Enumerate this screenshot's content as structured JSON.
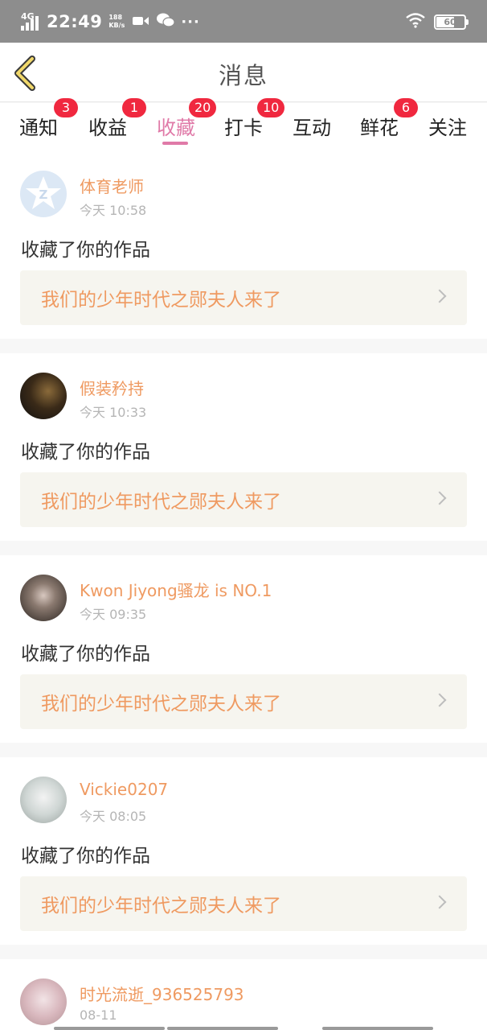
{
  "status_bar": {
    "network": "4G",
    "time": "22:49",
    "speed_value": "188",
    "speed_unit": "KB/s",
    "battery": "60"
  },
  "header": {
    "title": "消息"
  },
  "tabs": [
    {
      "label": "通知",
      "badge": "3"
    },
    {
      "label": "收益",
      "badge": "1"
    },
    {
      "label": "收藏",
      "badge": "20",
      "active": true
    },
    {
      "label": "打卡",
      "badge": "10"
    },
    {
      "label": "互动",
      "badge": ""
    },
    {
      "label": "鲜花",
      "badge": "6"
    },
    {
      "label": "关注",
      "badge": ""
    }
  ],
  "messages": [
    {
      "user": "体育老师",
      "time": "今天 10:58",
      "action": "收藏了你的作品",
      "work": "我们的少年时代之郧夫人来了"
    },
    {
      "user": "假装矜持",
      "time": "今天 10:33",
      "action": "收藏了你的作品",
      "work": "我们的少年时代之郧夫人来了"
    },
    {
      "user": "Kwon Jiyong骚龙 is NO.1",
      "time": "今天 09:35",
      "action": "收藏了你的作品",
      "work": "我们的少年时代之郧夫人来了"
    },
    {
      "user": "Vickie0207",
      "time": "今天 08:05",
      "action": "收藏了你的作品",
      "work": "我们的少年时代之郧夫人来了"
    },
    {
      "user": "时光流逝_936525793",
      "time": "08-11",
      "action": "",
      "work": ""
    }
  ],
  "colors": {
    "accent_pink": "#e07aa8",
    "name_orange": "#ef9a61",
    "badge_red": "#f0283f"
  }
}
